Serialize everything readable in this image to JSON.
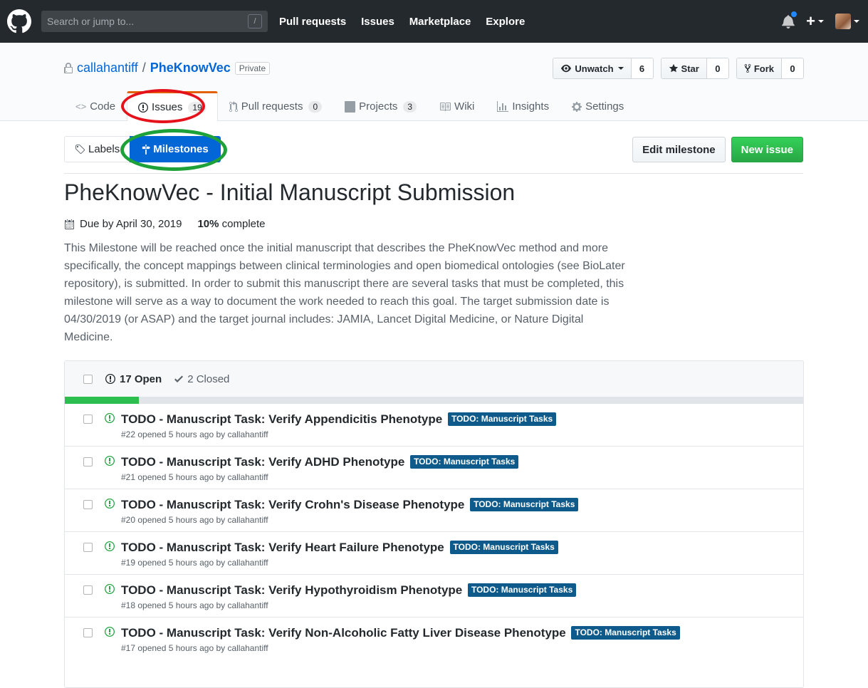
{
  "header": {
    "search_placeholder": "Search or jump to...",
    "search_key": "/",
    "nav": [
      "Pull requests",
      "Issues",
      "Marketplace",
      "Explore"
    ],
    "plus": "+"
  },
  "repo": {
    "owner": "callahantiff",
    "separator": "/",
    "name": "PheKnowVec",
    "visibility": "Private",
    "watch_label": "Unwatch",
    "watch_count": "6",
    "star_label": "Star",
    "star_count": "0",
    "fork_label": "Fork",
    "fork_count": "0"
  },
  "reponav": {
    "code": "Code",
    "issues": "Issues",
    "issues_count": "19",
    "pulls": "Pull requests",
    "pulls_count": "0",
    "projects": "Projects",
    "projects_count": "3",
    "wiki": "Wiki",
    "insights": "Insights",
    "settings": "Settings"
  },
  "subnav": {
    "labels": "Labels",
    "milestones": "Milestones",
    "edit": "Edit milestone",
    "new_issue": "New issue"
  },
  "milestone": {
    "title": "PheKnowVec - Initial Manuscript Submission",
    "due": "Due by April 30, 2019",
    "percent": "10%",
    "percent_suffix": "complete",
    "progress": 0.1,
    "description": "This Milestone will be reached once the initial manuscript that describes the PheKnowVec method and more specifically, the concept mappings between clinical terminologies and open biomedical ontologies (see BioLater repository), is submitted. In order to submit this manuscript there are several tasks that must be completed, this milestone will serve as a way to document the work needed to reach this goal. The target submission date is 04/30/2019 (or ASAP) and the target journal includes: JAMIA, Lancet Digital Medicine, or Nature Digital Medicine."
  },
  "issues_table": {
    "open_label": "17 Open",
    "closed_label": "2 Closed",
    "rows": [
      {
        "title": "TODO - Manuscript Task: Verify Appendicitis Phenotype",
        "label": "TODO: Manuscript Tasks",
        "meta": "#22 opened 5 hours ago by callahantiff"
      },
      {
        "title": "TODO - Manuscript Task: Verify ADHD Phenotype",
        "label": "TODO: Manuscript Tasks",
        "meta": "#21 opened 5 hours ago by callahantiff"
      },
      {
        "title": "TODO - Manuscript Task: Verify Crohn's Disease Phenotype",
        "label": "TODO: Manuscript Tasks",
        "meta": "#20 opened 5 hours ago by callahantiff"
      },
      {
        "title": "TODO - Manuscript Task: Verify Heart Failure Phenotype",
        "label": "TODO: Manuscript Tasks",
        "meta": "#19 opened 5 hours ago by callahantiff"
      },
      {
        "title": "TODO - Manuscript Task: Verify Hypothyroidism Phenotype",
        "label": "TODO: Manuscript Tasks",
        "meta": "#18 opened 5 hours ago by callahantiff"
      },
      {
        "title": "TODO - Manuscript Task: Verify Non-Alcoholic Fatty Liver Disease Phenotype",
        "label": "TODO: Manuscript Tasks",
        "meta": "#17 opened 5 hours ago by callahantiff"
      }
    ]
  },
  "colors": {
    "header_bg": "#24292e",
    "link": "#0366d6",
    "label_bg": "#0e5a8a",
    "progress": "#2cbe4e",
    "annotation_red": "#e5121c",
    "annotation_green": "#1fa13a"
  }
}
